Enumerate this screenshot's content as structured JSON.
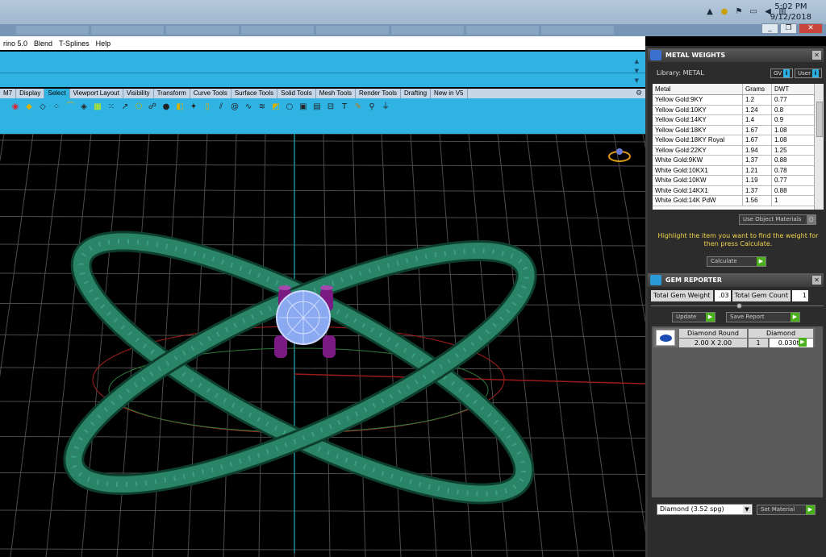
{
  "taskbar": {
    "clock": {
      "time": "5:02 PM",
      "date": "9/12/2018"
    }
  },
  "window": {
    "min": "_",
    "max": "❐",
    "close": "✕"
  },
  "menu": {
    "items": [
      "rino 5.0",
      "Blend",
      "T-Splines",
      "Help"
    ]
  },
  "toolbar_tabs": {
    "items": [
      "M7",
      "Display",
      "Select",
      "Viewport Layout",
      "Visibility",
      "Transform",
      "Curve Tools",
      "Surface Tools",
      "Solid Tools",
      "Mesh Tools",
      "Render Tools",
      "Drafting",
      "New in V5"
    ],
    "active": "Select"
  },
  "metal_weights": {
    "title": "METAL WEIGHTS",
    "library": "Library: METAL",
    "gv_label": "GV",
    "user_label": "User",
    "columns": [
      "Metal",
      "Grams",
      "DWT"
    ],
    "rows": [
      [
        "Yellow Gold:9KY",
        "1.2",
        "0.77"
      ],
      [
        "Yellow Gold:10KY",
        "1.24",
        "0.8"
      ],
      [
        "Yellow Gold:14KY",
        "1.4",
        "0.9"
      ],
      [
        "Yellow Gold:18KY",
        "1.67",
        "1.08"
      ],
      [
        "Yellow Gold:18KY Royal",
        "1.67",
        "1.08"
      ],
      [
        "Yellow Gold:22KY",
        "1.94",
        "1.25"
      ],
      [
        "White Gold:9KW",
        "1.37",
        "0.88"
      ],
      [
        "White Gold:10KX1",
        "1.21",
        "0.78"
      ],
      [
        "White Gold:10KW",
        "1.19",
        "0.77"
      ],
      [
        "White Gold:14KX1",
        "1.37",
        "0.88"
      ],
      [
        "White Gold:14K PdW",
        "1.56",
        "1"
      ]
    ],
    "use_object_materials": "Use Object Materials",
    "instruction": "Highlight the item you want to find the weight for then press Calculate.",
    "calculate": "Calculate"
  },
  "gem_reporter": {
    "title": "GEM REPORTER",
    "total_weight_label": "Total Gem Weight",
    "total_weight_value": ".03",
    "total_count_label": "Total Gem Count",
    "total_count_value": "1",
    "update": "Update",
    "save_report": "Save Report",
    "gem": {
      "name": "Diamond Round",
      "size": "2.00 X 2.00",
      "material": "Diamond",
      "count": "1",
      "weight": "0.030tw"
    },
    "material_select": "Diamond   (3.52 spg)",
    "set_material": "Set Material"
  }
}
